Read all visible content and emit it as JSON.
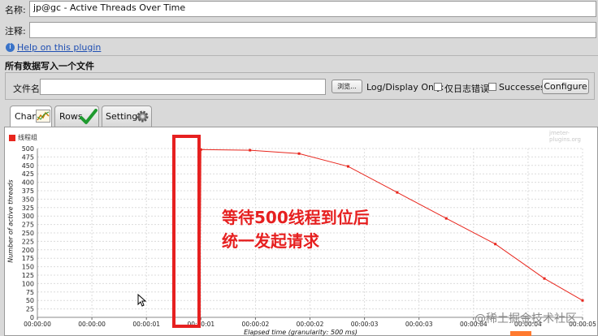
{
  "form": {
    "name_label": "名称:",
    "name_value": "jp@gc - Active Threads Over Time",
    "comment_label": "注释:",
    "comment_value": "",
    "help_link": "Help on this plugin"
  },
  "file_section": {
    "title": "所有数据写入一个文件",
    "filename_label": "文件名",
    "filename_value": "",
    "browse_label": "浏览...",
    "log_display_label": "Log/Display Only:",
    "errors_only_label": "仅日志错误",
    "successes_label": "Successes",
    "configure_label": "Configure"
  },
  "tabs": [
    {
      "label": "Chart",
      "icon": "chart-icon",
      "active": true
    },
    {
      "label": "Rows",
      "icon": "checkmark-icon",
      "active": false
    },
    {
      "label": "Settings",
      "icon": "gear-icon",
      "active": false
    }
  ],
  "colors": {
    "series": "#e8261d",
    "highlight": "#e62020",
    "annotation": "#e62020"
  },
  "chart_data": {
    "type": "line",
    "watermark": "jmeter-plugins.org",
    "legend": [
      {
        "name": "线程组",
        "color": "#e8261d",
        "position": "top-left"
      }
    ],
    "xlabel": "Elapsed time (granularity: 500 ms)",
    "ylabel": "Number of active threads",
    "ylim": [
      0,
      500
    ],
    "yticks": [
      0,
      25,
      50,
      75,
      100,
      125,
      150,
      175,
      200,
      225,
      250,
      275,
      300,
      325,
      350,
      375,
      400,
      425,
      450,
      475,
      500
    ],
    "xticks": [
      "00:00:00",
      "00:00:00",
      "00:00:01",
      "00:00:01",
      "00:00:02",
      "00:00:02",
      "00:00:03",
      "00:00:03",
      "00:00:04",
      "00:00:04",
      "00:00:05"
    ],
    "xlim_seconds": [
      0,
      5.0
    ],
    "grid": true,
    "series": [
      {
        "name": "线程组",
        "x_seconds": [
          1.49,
          1.5,
          1.95,
          2.4,
          2.85,
          3.3,
          3.75,
          4.2,
          4.65,
          5.0
        ],
        "y": [
          0,
          497,
          495,
          485,
          447,
          370,
          293,
          217,
          115,
          50
        ]
      }
    ]
  },
  "annotation": {
    "line1": "等待500线程到位后",
    "line2": "统一发起请求"
  },
  "footer_watermark": "@稀土掘金技术社区"
}
